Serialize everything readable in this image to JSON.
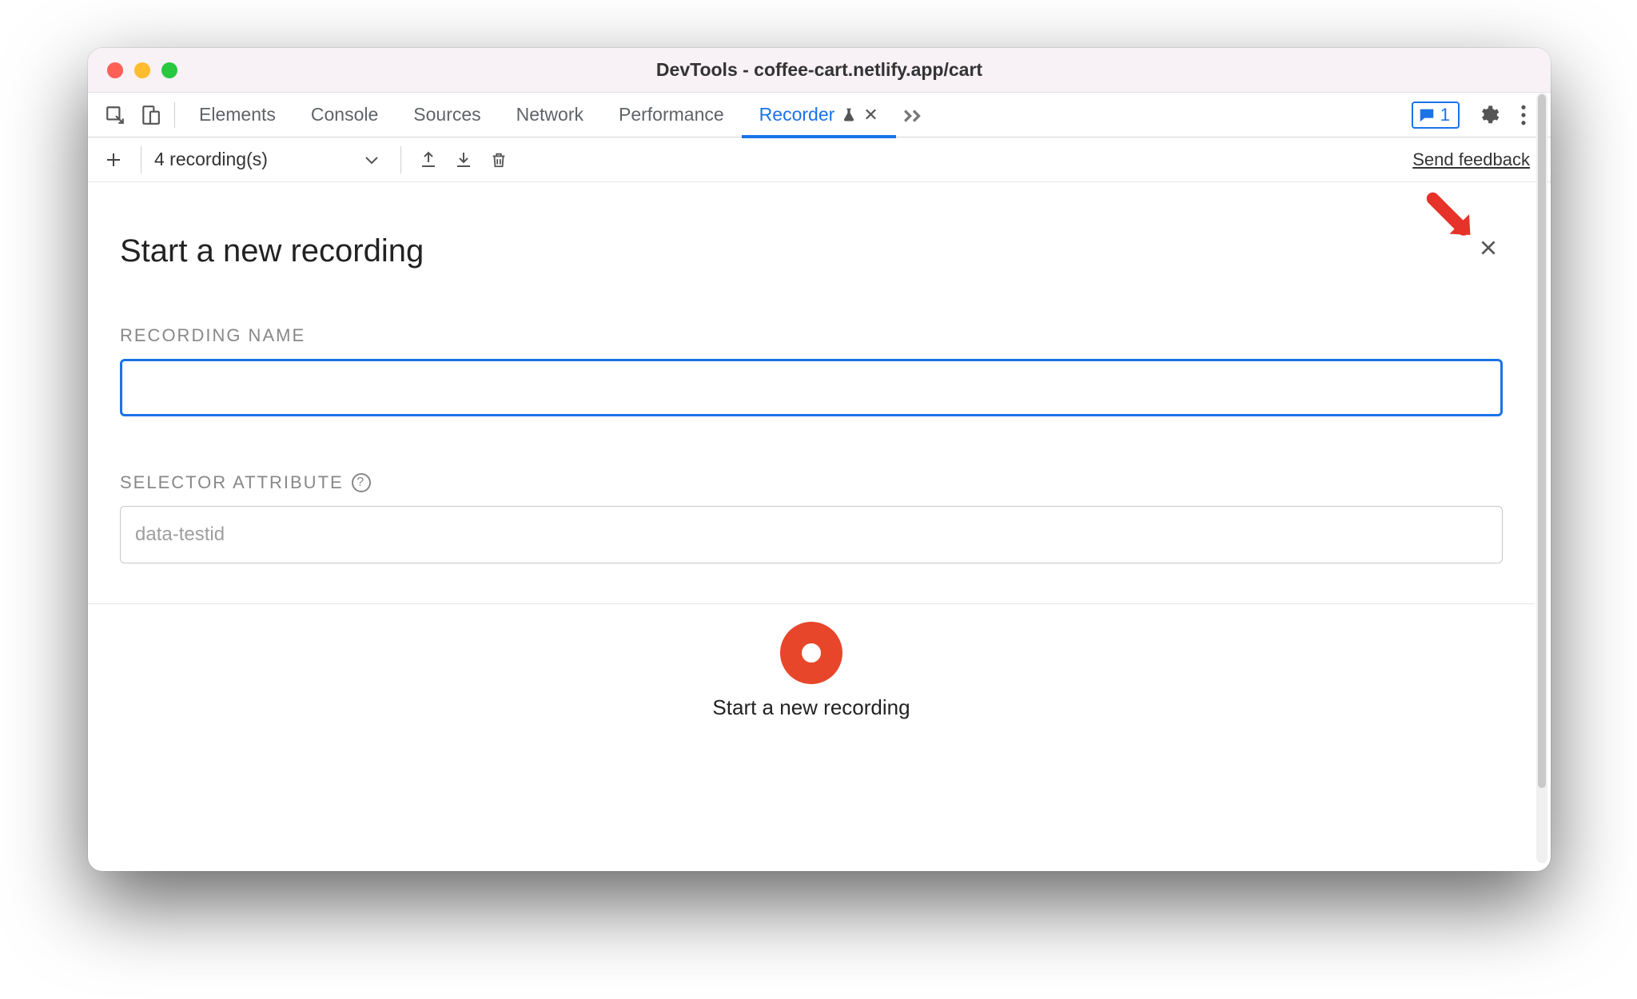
{
  "titlebar": {
    "title": "DevTools - coffee-cart.netlify.app/cart"
  },
  "tabs": {
    "items": [
      "Elements",
      "Console",
      "Sources",
      "Network",
      "Performance",
      "Recorder"
    ],
    "active": "Recorder",
    "badge_count": "1"
  },
  "toolbar": {
    "recordings_label": "4 recording(s)",
    "feedback_label": "Send feedback"
  },
  "panel": {
    "title": "Start a new recording",
    "recording_name_label": "RECORDING NAME",
    "recording_name_value": "",
    "selector_attr_label": "SELECTOR ATTRIBUTE",
    "selector_attr_placeholder": "data-testid",
    "selector_attr_value": "",
    "start_button_label": "Start a new recording"
  }
}
